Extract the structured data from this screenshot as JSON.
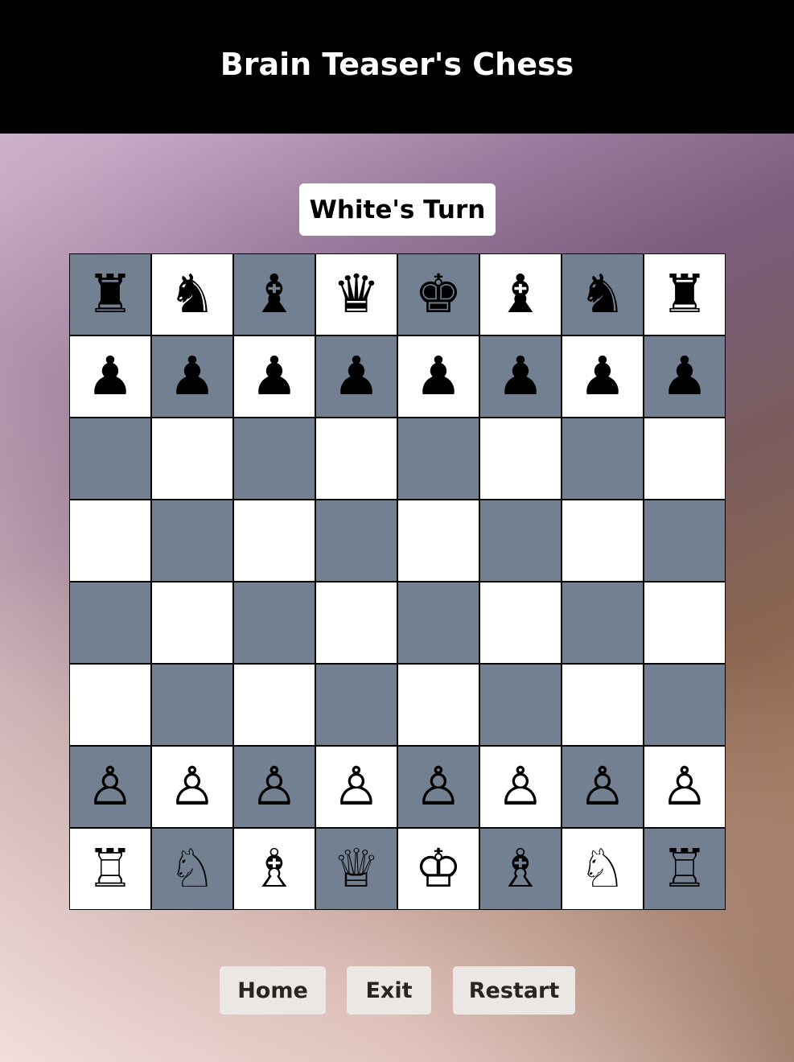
{
  "header": {
    "title": "Brain Teaser's Chess",
    "background": "#000000"
  },
  "status": {
    "turn_label": "White's Turn"
  },
  "board": {
    "light_color": "#ffffff",
    "dark_color": "#738091",
    "rows": [
      [
        {
          "glyph": "♜",
          "piece": "black-rook"
        },
        {
          "glyph": "♞",
          "piece": "black-knight"
        },
        {
          "glyph": "♝",
          "piece": "black-bishop"
        },
        {
          "glyph": "♛",
          "piece": "black-queen"
        },
        {
          "glyph": "♚",
          "piece": "black-king"
        },
        {
          "glyph": "♝",
          "piece": "black-bishop"
        },
        {
          "glyph": "♞",
          "piece": "black-knight"
        },
        {
          "glyph": "♜",
          "piece": "black-rook"
        }
      ],
      [
        {
          "glyph": "♟",
          "piece": "black-pawn"
        },
        {
          "glyph": "♟",
          "piece": "black-pawn"
        },
        {
          "glyph": "♟",
          "piece": "black-pawn"
        },
        {
          "glyph": "♟",
          "piece": "black-pawn"
        },
        {
          "glyph": "♟",
          "piece": "black-pawn"
        },
        {
          "glyph": "♟",
          "piece": "black-pawn"
        },
        {
          "glyph": "♟",
          "piece": "black-pawn"
        },
        {
          "glyph": "♟",
          "piece": "black-pawn"
        }
      ],
      [
        {},
        {},
        {},
        {},
        {},
        {},
        {},
        {}
      ],
      [
        {},
        {},
        {},
        {},
        {},
        {},
        {},
        {}
      ],
      [
        {},
        {},
        {},
        {},
        {},
        {},
        {},
        {}
      ],
      [
        {},
        {},
        {},
        {},
        {},
        {},
        {},
        {}
      ],
      [
        {
          "glyph": "♙",
          "piece": "white-pawn"
        },
        {
          "glyph": "♙",
          "piece": "white-pawn"
        },
        {
          "glyph": "♙",
          "piece": "white-pawn"
        },
        {
          "glyph": "♙",
          "piece": "white-pawn"
        },
        {
          "glyph": "♙",
          "piece": "white-pawn"
        },
        {
          "glyph": "♙",
          "piece": "white-pawn"
        },
        {
          "glyph": "♙",
          "piece": "white-pawn"
        },
        {
          "glyph": "♙",
          "piece": "white-pawn"
        }
      ],
      [
        {
          "glyph": "♖",
          "piece": "white-rook"
        },
        {
          "glyph": "♘",
          "piece": "white-knight"
        },
        {
          "glyph": "♗",
          "piece": "white-bishop"
        },
        {
          "glyph": "♕",
          "piece": "white-queen"
        },
        {
          "glyph": "♔",
          "piece": "white-king"
        },
        {
          "glyph": "♗",
          "piece": "white-bishop"
        },
        {
          "glyph": "♘",
          "piece": "white-knight"
        },
        {
          "glyph": "♖",
          "piece": "white-rook"
        }
      ]
    ]
  },
  "controls": {
    "home_label": "Home",
    "exit_label": "Exit",
    "restart_label": "Restart"
  }
}
